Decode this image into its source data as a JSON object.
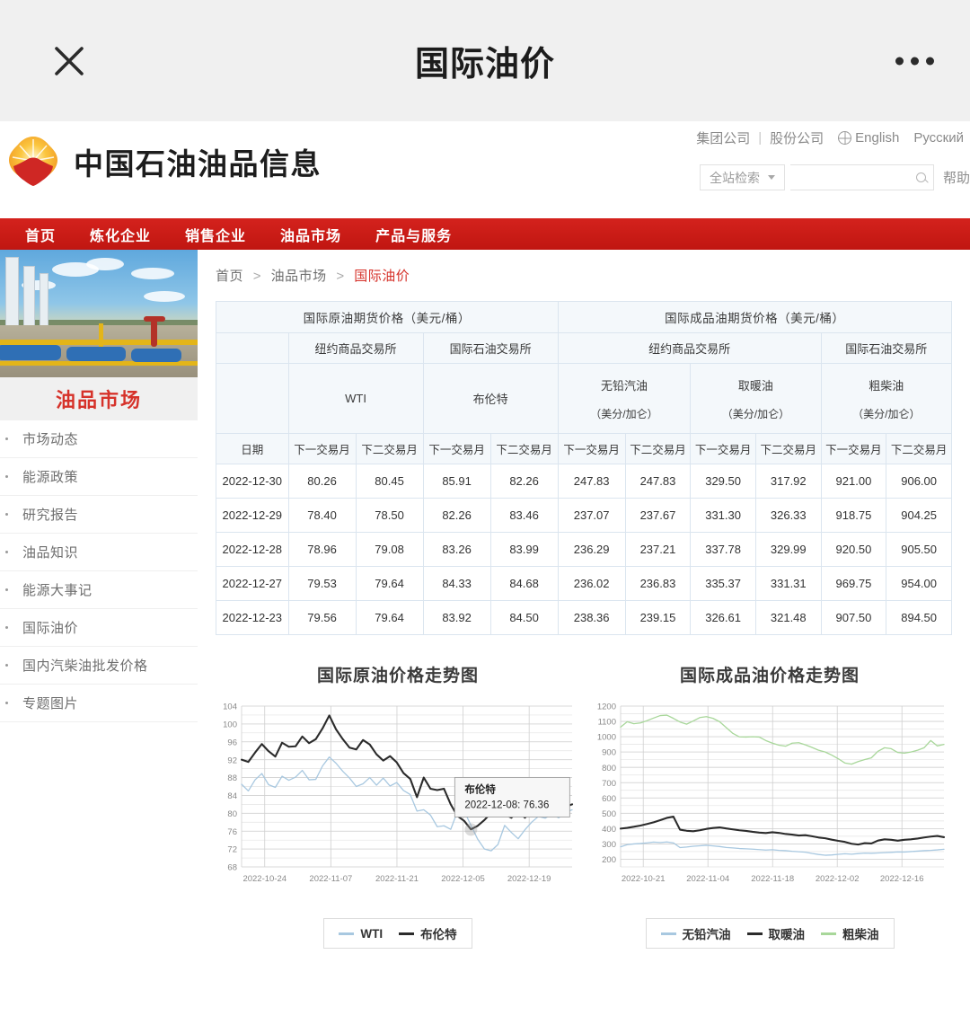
{
  "topbar": {
    "title": "国际油价",
    "close_icon": "close-icon",
    "more_icon": "more-dots-icon"
  },
  "header": {
    "brand": "中国石油油品信息",
    "links": [
      {
        "label": "集团公司"
      },
      {
        "label": "|"
      },
      {
        "label": "股份公司"
      },
      {
        "label": "English"
      },
      {
        "label": "Русский"
      }
    ],
    "search": {
      "scope_label": "全站检索",
      "input_value": "",
      "placeholder": "",
      "help_label": "帮助"
    }
  },
  "nav": {
    "items": [
      "首页",
      "炼化企业",
      "销售企业",
      "油品市场",
      "产品与服务"
    ]
  },
  "sidebar": {
    "title": "油品市场",
    "items": [
      "市场动态",
      "能源政策",
      "研究报告",
      "油品知识",
      "能源大事记",
      "国际油价",
      "国内汽柴油批发价格",
      "专题图片"
    ]
  },
  "breadcrumb": {
    "home": "首页",
    "section": "油品市场",
    "current": "国际油价",
    "sep": ">"
  },
  "table": {
    "group_headers": [
      "国际原油期货价格（美元/桶）",
      "国际成品油期货价格（美元/桶）"
    ],
    "exchanges": [
      "纽约商品交易所",
      "国际石油交易所",
      "纽约商品交易所",
      "国际石油交易所"
    ],
    "products": [
      {
        "name": "WTI",
        "unit": ""
      },
      {
        "name": "布伦特",
        "unit": ""
      },
      {
        "name": "无铅汽油",
        "unit": "（美分/加仑）"
      },
      {
        "name": "取暖油",
        "unit": "（美分/加仑）"
      },
      {
        "name": "粗柴油",
        "unit": "（美分/加仑）"
      }
    ],
    "date_header": "日期",
    "month_headers": [
      "下一交易月",
      "下二交易月"
    ],
    "rows": [
      {
        "date": "2022-12-30",
        "values": [
          "80.26",
          "80.45",
          "85.91",
          "82.26",
          "247.83",
          "247.83",
          "329.50",
          "317.92",
          "921.00",
          "906.00"
        ]
      },
      {
        "date": "2022-12-29",
        "values": [
          "78.40",
          "78.50",
          "82.26",
          "83.46",
          "237.07",
          "237.67",
          "331.30",
          "326.33",
          "918.75",
          "904.25"
        ]
      },
      {
        "date": "2022-12-28",
        "values": [
          "78.96",
          "79.08",
          "83.26",
          "83.99",
          "236.29",
          "237.21",
          "337.78",
          "329.99",
          "920.50",
          "905.50"
        ]
      },
      {
        "date": "2022-12-27",
        "values": [
          "79.53",
          "79.64",
          "84.33",
          "84.68",
          "236.02",
          "236.83",
          "335.37",
          "331.31",
          "969.75",
          "954.00"
        ]
      },
      {
        "date": "2022-12-23",
        "values": [
          "79.56",
          "79.64",
          "83.92",
          "84.50",
          "238.36",
          "239.15",
          "326.61",
          "321.48",
          "907.50",
          "894.50"
        ]
      }
    ]
  },
  "colors": {
    "brand_red": "#c8201a",
    "accent_red": "#d6322a",
    "wti_blue": "#a8c8e0",
    "brent_black": "#2b2b2b",
    "gasoline_blue": "#a8c8e0",
    "heating_black": "#2b2b2b",
    "gasoil_green": "#a8d79a"
  },
  "chart_data": [
    {
      "type": "line",
      "title": "国际原油价格走势图",
      "xlabel": "",
      "ylabel": "",
      "ylim": [
        68,
        104
      ],
      "yticks": [
        68,
        72,
        76,
        80,
        84,
        88,
        92,
        96,
        100,
        104
      ],
      "xticks": [
        "2022-10-24",
        "2022-11-07",
        "2022-11-21",
        "2022-12-05",
        "2022-12-19"
      ],
      "grid": true,
      "legend_position": "bottom",
      "tooltip": {
        "series": "布伦特",
        "text": "2022-12-08: 76.36",
        "date": "2022-12-08",
        "value": 76.36
      },
      "series": [
        {
          "name": "WTI",
          "color": "#a8c8e0",
          "values": [
            86.5,
            85.0,
            87.5,
            88.9,
            86.4,
            85.8,
            88.3,
            87.4,
            88.1,
            89.6,
            87.5,
            87.6,
            90.6,
            92.6,
            91.2,
            89.4,
            87.9,
            86.0,
            86.6,
            88.0,
            86.3,
            87.9,
            86.1,
            86.9,
            85.1,
            84.2,
            80.5,
            80.8,
            79.6,
            77.0,
            77.2,
            76.4,
            80.4,
            80.5,
            77.3,
            74.2,
            72.0,
            71.6,
            73.0,
            77.3,
            75.7,
            74.3,
            76.3,
            78.0,
            79.3,
            78.9,
            79.8,
            79.0,
            80.2,
            80.8
          ]
        },
        {
          "name": "布伦特",
          "color": "#2b2b2b",
          "values": [
            92.0,
            91.5,
            93.6,
            95.5,
            93.9,
            92.7,
            95.8,
            94.9,
            95.0,
            97.2,
            95.7,
            96.6,
            99.0,
            101.9,
            98.8,
            96.6,
            94.7,
            94.3,
            96.4,
            95.4,
            93.2,
            91.8,
            92.8,
            91.4,
            89.0,
            87.7,
            83.6,
            88.0,
            85.5,
            85.2,
            85.5,
            82.0,
            79.4,
            78.3,
            76.4,
            77.2,
            78.5,
            80.1,
            79.6,
            79.8,
            79.0,
            80.5,
            79.0,
            80.5,
            80.2,
            80.9,
            81.2,
            81.0,
            81.5,
            82.0
          ]
        }
      ]
    },
    {
      "type": "line",
      "title": "国际成品油价格走势图",
      "xlabel": "",
      "ylabel": "",
      "ylim": [
        150,
        1200
      ],
      "yticks": [
        200,
        300,
        400,
        500,
        600,
        700,
        800,
        900,
        1000,
        1100,
        1200
      ],
      "xticks": [
        "2022-10-21",
        "2022-11-04",
        "2022-11-18",
        "2022-12-02",
        "2022-12-16"
      ],
      "grid": true,
      "legend_position": "bottom",
      "series": [
        {
          "name": "无铅汽油",
          "color": "#a8c8e0",
          "values": [
            281,
            295,
            300,
            303,
            307,
            312,
            309,
            313,
            307,
            276,
            280,
            285,
            288,
            291,
            287,
            283,
            277,
            274,
            270,
            268,
            266,
            263,
            260,
            262,
            258,
            256,
            252,
            249,
            246,
            238,
            231,
            226,
            228,
            232,
            236,
            233,
            237,
            240,
            239,
            241,
            243,
            245,
            248,
            247,
            250,
            253,
            256,
            258,
            261,
            265
          ]
        },
        {
          "name": "取暖油",
          "color": "#2b2b2b",
          "values": [
            400,
            405,
            412,
            420,
            430,
            441,
            455,
            470,
            478,
            393,
            386,
            383,
            389,
            398,
            404,
            408,
            401,
            395,
            389,
            385,
            379,
            374,
            371,
            376,
            372,
            365,
            361,
            355,
            357,
            350,
            342,
            337,
            328,
            320,
            313,
            301,
            296,
            305,
            303,
            322,
            330,
            327,
            321,
            327,
            330,
            335,
            342,
            348,
            352,
            344
          ]
        },
        {
          "name": "粗柴油",
          "color": "#a8d79a",
          "values": [
            1063,
            1098,
            1085,
            1090,
            1105,
            1122,
            1138,
            1141,
            1120,
            1096,
            1082,
            1103,
            1125,
            1131,
            1120,
            1098,
            1060,
            1022,
            999,
            998,
            1000,
            998,
            975,
            958,
            945,
            938,
            958,
            961,
            947,
            930,
            912,
            900,
            880,
            856,
            828,
            821,
            838,
            851,
            862,
            905,
            928,
            922,
            897,
            893,
            900,
            912,
            928,
            975,
            940,
            950
          ]
        }
      ]
    }
  ]
}
